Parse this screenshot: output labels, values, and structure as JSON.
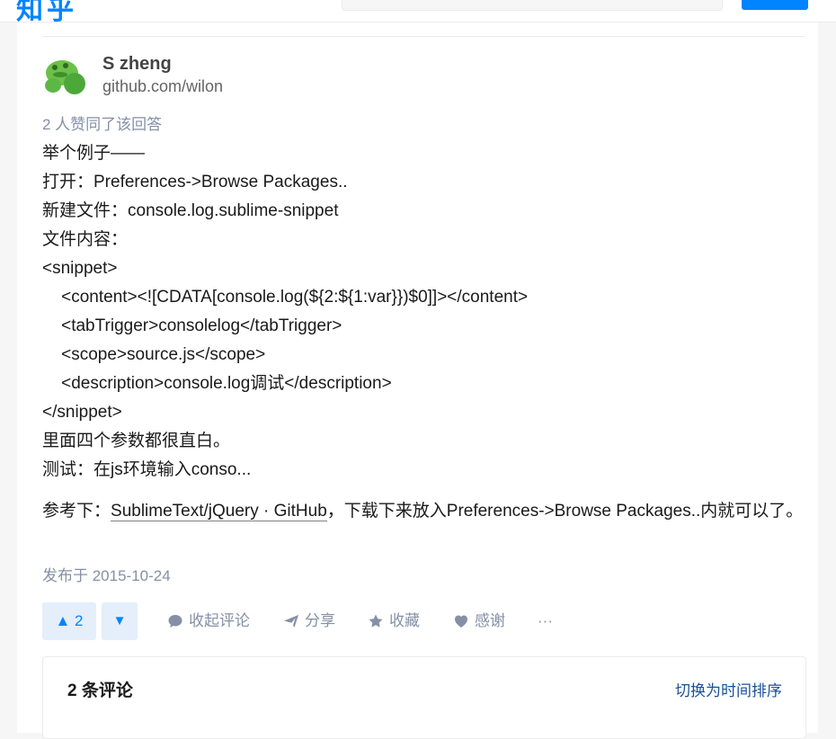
{
  "header": {
    "logo": "知乎",
    "search": {
      "placeholder": ""
    },
    "ask_button_label": ""
  },
  "answer": {
    "author": {
      "name": "S zheng",
      "bio": "github.com/wilon"
    },
    "vote_summary": "2 人赞同了该回答",
    "content_lines": [
      "举个例子——",
      "打开：Preferences->Browse Packages..",
      "新建文件：console.log.sublime-snippet",
      "文件内容：",
      "<snippet>",
      "    <content><![CDATA[console.log(${2:${1:var}})$0]]></content>",
      "    <tabTrigger>consolelog</tabTrigger>",
      "    <scope>source.js</scope>",
      "    <description>console.log调试</description>",
      "</snippet>",
      "里面四个参数都很直白。",
      "测试：在js环境输入conso..."
    ],
    "reference": {
      "prefix": "参考下：",
      "link_text": "SublimeText/jQuery · GitHub",
      "suffix": "，下载下来放入Preferences->Browse Packages..内就可以了。"
    },
    "publish_date": "发布于 2015-10-24",
    "actions": {
      "upvote_count": "2",
      "collapse_comments": "收起评论",
      "share": "分享",
      "favorite": "收藏",
      "thanks": "感谢",
      "more": "···"
    },
    "comments": {
      "count_label": "2 条评论",
      "sort_toggle": "切换为时间排序"
    }
  },
  "colors": {
    "brand": "#0084ff",
    "muted": "#8590a6",
    "link": "#175199"
  }
}
